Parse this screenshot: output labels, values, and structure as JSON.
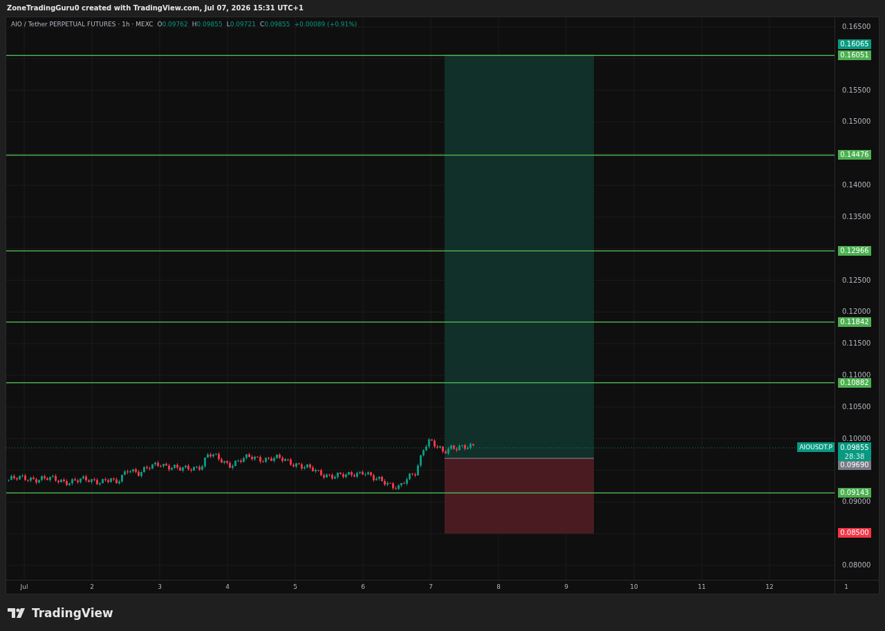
{
  "caption": "ZoneTradingGuru0 created with TradingView.com, Jul 07, 2026 15:31 UTC+1",
  "legend": {
    "title": "AIO / Tether PERPETUAL FUTURES · 1h · MEXC",
    "ohlc": [
      {
        "label": "O",
        "value": "0.09762"
      },
      {
        "label": "H",
        "value": "0.09855"
      },
      {
        "label": "L",
        "value": "0.09721"
      },
      {
        "label": "C",
        "value": "0.09855"
      }
    ],
    "change": "+0.00089 (+0.91%)"
  },
  "price_scale": {
    "ticks": [
      "0.16500",
      "0.15500",
      "0.15000",
      "0.14000",
      "0.13500",
      "0.12500",
      "0.12000",
      "0.11500",
      "0.11000",
      "0.10500",
      "0.10000",
      "0.09000",
      "0.08000"
    ]
  },
  "levels": [
    {
      "price": "0.16051"
    },
    {
      "price": "0.14476"
    },
    {
      "price": "0.12966"
    },
    {
      "price": "0.11842"
    },
    {
      "price": "0.10882"
    },
    {
      "price": "0.09143"
    }
  ],
  "position": {
    "target": "0.16065",
    "entry": "0.09690",
    "stop": "0.08500"
  },
  "last_price": {
    "symbol": "AIOUSDT.P",
    "price": "0.09855",
    "countdown": "28:38"
  },
  "time_axis": {
    "labels": [
      "Jul",
      "2",
      "3",
      "4",
      "5",
      "6",
      "7",
      "8",
      "9",
      "10",
      "11",
      "12",
      "1"
    ]
  },
  "footer": {
    "brand": "TradingView"
  }
}
